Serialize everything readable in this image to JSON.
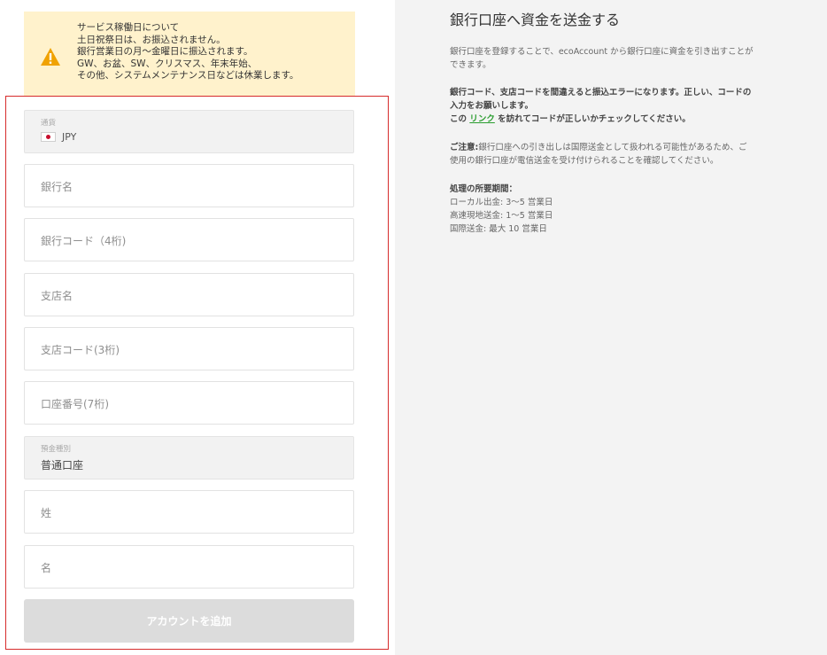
{
  "notice": {
    "icon": "warning-triangle-icon",
    "lines": [
      "サービス稼働日について",
      "土日祝祭日は、お振込されません。",
      "銀行営業日の月～金曜日に振込されます。",
      "GW、お盆、SW、クリスマス、年末年始、",
      "その他、システムメンテナンス日などは休業します。"
    ],
    "background": "#fff2cc",
    "icon_color": "#f0a202"
  },
  "form": {
    "currency": {
      "label": "通貨",
      "flag": "japan-flag-icon",
      "value": "JPY"
    },
    "bank_name": {
      "placeholder": "銀行名"
    },
    "bank_code": {
      "placeholder": "銀行コード（4桁)"
    },
    "branch_name": {
      "placeholder": "支店名"
    },
    "branch_code": {
      "placeholder": "支店コード(3桁)"
    },
    "account_number": {
      "placeholder": "口座番号(7桁)"
    },
    "deposit_type": {
      "label": "預金種別",
      "value": "普通口座"
    },
    "last_name": {
      "placeholder": "姓"
    },
    "first_name": {
      "placeholder": "名"
    },
    "submit_label": "アカウントを追加"
  },
  "info": {
    "title": "銀行口座へ資金を送金する",
    "intro_line1": "銀行口座を登録することで、ecoAccount から銀行口座に資金を引き出すことが",
    "intro_line2": "できます。",
    "warn_line1": "銀行コード、支店コードを間違えると振込エラーになります。正しい、コードの",
    "warn_line2": "入力をお願いします。",
    "link_prefix": "この",
    "link_text": "リンク",
    "link_suffix": "を訪れてコードが正しいかチェックしてください。",
    "caution_label": "ご注意:",
    "caution_line1": "銀行口座への引き出しは国際送金として扱われる可能性があるため、ご",
    "caution_line2": "使用の銀行口座が電信送金を受け付けられることを確認してください。",
    "processing_title": "処理の所要期間：",
    "processing": [
      "ローカル出金: 3～5 営業日",
      "高速現地送金: 1～5 営業日",
      "国際送金: 最大 10 営業日"
    ],
    "link_color": "#2a9d2f"
  },
  "highlight_color": "#d62b2b"
}
